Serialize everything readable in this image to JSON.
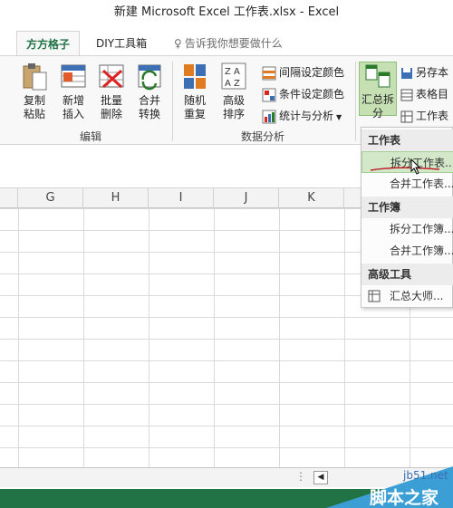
{
  "window": {
    "title": "新建 Microsoft Excel 工作表.xlsx - Excel"
  },
  "tabs": [
    {
      "label": "方方格子",
      "active": true
    },
    {
      "label": "DIY工具箱",
      "active": false
    }
  ],
  "tell_me": "告诉我你想要做什么",
  "ribbon": {
    "edit": {
      "copy_paste": "复制粘贴",
      "insert": "新增插入",
      "batch_delete": "批量删除",
      "merge_convert": "合并转换",
      "group_label": "编辑"
    },
    "data_analysis": {
      "random_repeat": "随机重复",
      "advanced_sort": "高级排序",
      "interval_color": "间隔设定颜色",
      "conditional_color": "条件设定颜色",
      "stats_analysis": "统计与分析",
      "group_label": "数据分析"
    },
    "summary": {
      "summary_split": "汇总拆分",
      "save_as": "另存本",
      "table_dir": "表格目",
      "worksheet": "工作表"
    }
  },
  "columns": [
    "G",
    "H",
    "I",
    "J",
    "K"
  ],
  "dropdown": {
    "worksheet_header": "工作表",
    "split_worksheet": "拆分工作表...",
    "merge_worksheet": "合并工作表...",
    "workbook_header": "工作簿",
    "split_workbook": "拆分工作簿...",
    "merge_workbook": "合并工作簿...",
    "advanced_header": "高级工具",
    "summary_master": "汇总大师..."
  },
  "watermark": {
    "url": "jb51.net",
    "site": "脚本之家"
  },
  "colors": {
    "excel_green": "#217346",
    "highlight": "#c6e0b4"
  }
}
